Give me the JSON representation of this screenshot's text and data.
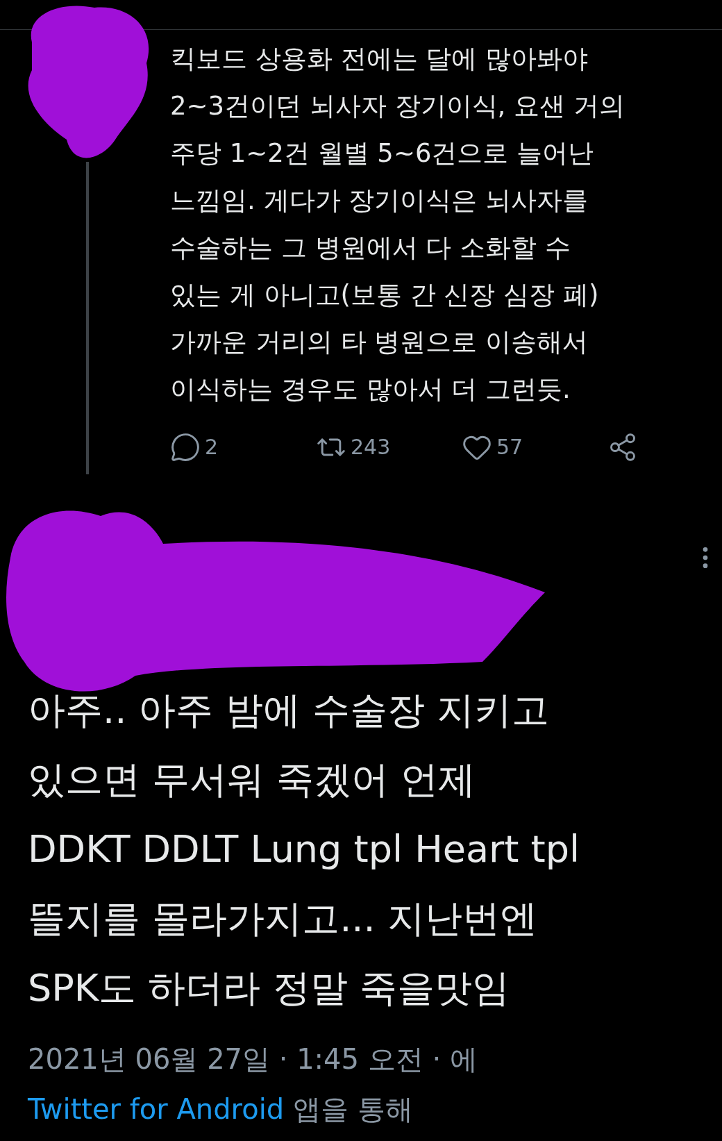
{
  "thread_tweet": {
    "lines": [
      "킥보드 상용화 전에는 달에 많아봐야",
      "2~3건이던 뇌사자 장기이식, 요샌 거의",
      "주당 1~2건 월별 5~6건으로 늘어난",
      "느낌임. 게다가 장기이식은 뇌사자를",
      "수술하는 그 병원에서 다 소화할 수",
      "있는 게 아니고(보통 간 신장 심장 폐)",
      "가까운 거리의 타 병원으로 이송해서",
      "이식하는 경우도 많아서 더 그런듯."
    ],
    "actions": [
      {
        "kind": "reply",
        "count": "2"
      },
      {
        "kind": "retweet",
        "count": "243"
      },
      {
        "kind": "like",
        "count": "57"
      },
      {
        "kind": "share"
      }
    ]
  },
  "main_tweet": {
    "lines": [
      "아주.. 아주 밤에 수술장 지키고",
      "있으면 무서워 죽겠어 언제",
      "DDKT DDLT Lung tpl Heart tpl",
      "뜰지를 몰라가지고... 지난번엔",
      "SPK도 하더라 정말 죽을맛임"
    ],
    "timestamp": "2021년 06월 27일 · 1:45 오전 · 에",
    "source_link": "Twitter for Android",
    "source_suffix": "앱을 통해"
  }
}
